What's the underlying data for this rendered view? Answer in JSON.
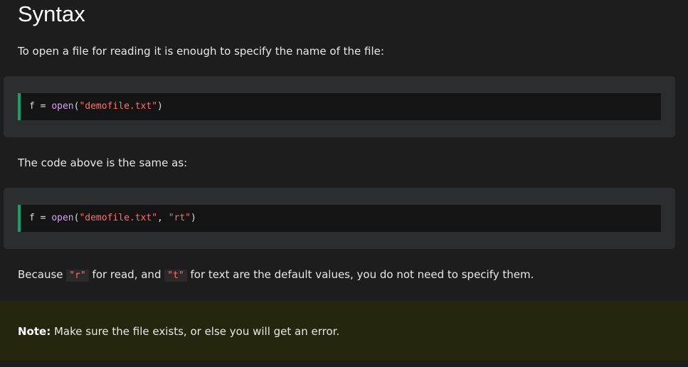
{
  "heading": "Syntax",
  "intro_text": "To open a file for reading it is enough to specify the name of the file:",
  "example1": {
    "var": "f",
    "op": "=",
    "fn": "open",
    "open_paren": "(",
    "arg1": "\"demofile.txt\"",
    "close_paren": ")"
  },
  "same_as_text": "The code above is the same as:",
  "example2": {
    "var": "f",
    "op": "=",
    "fn": "open",
    "open_paren": "(",
    "arg1": "\"demofile.txt\"",
    "comma": ",",
    "arg2": "\"rt\"",
    "close_paren": ")"
  },
  "because": {
    "part1": "Because ",
    "code_r": "\"r\"",
    "part2": " for read, and ",
    "code_t": "\"t\"",
    "part3": " for text are the default values, you do not need to specify them."
  },
  "note": {
    "label": "Note:",
    "text": " Make sure the file exists, or else you will get an error."
  },
  "colors": {
    "background": "#1d1d1d",
    "example_bg": "#2c2d2f",
    "code_bg": "#141414",
    "code_border": "#04aa6d",
    "string": "#ff6e6e",
    "function": "#d9a1f2",
    "note_bg": "#25260d"
  }
}
